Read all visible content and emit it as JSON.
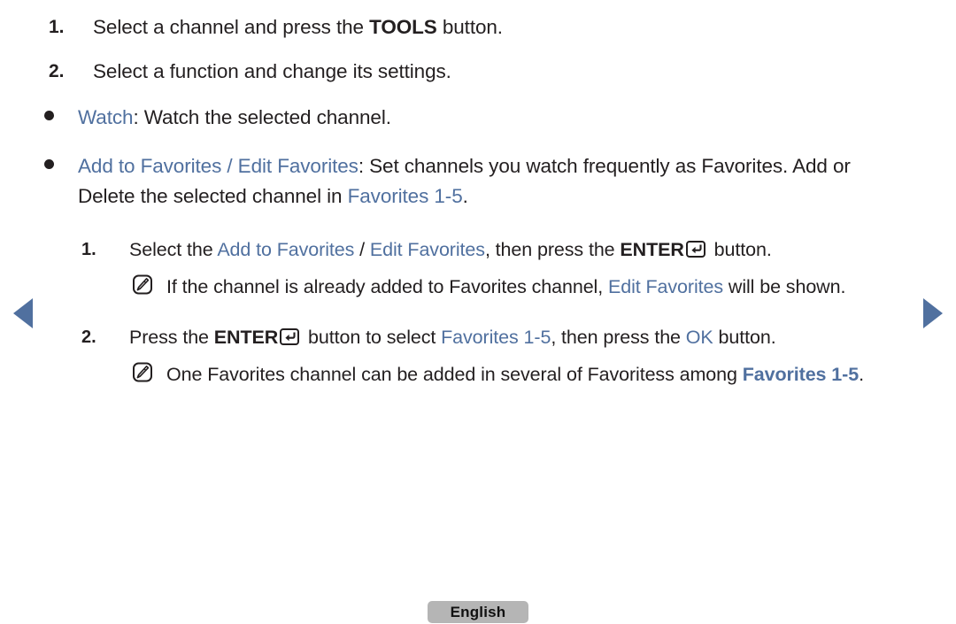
{
  "meta": {
    "accent_blue": "#50709f",
    "text_color": "#231f20",
    "badge_bg": "#b5b5b5",
    "background": "#ffffff"
  },
  "nav": {
    "prev_label": "previous page",
    "next_label": "next page",
    "prev_icon": "triangle-left-icon",
    "next_icon": "triangle-right-icon"
  },
  "steps": [
    {
      "number": "1.",
      "parts": [
        {
          "text": "Select a channel and press the ",
          "style": "plain"
        },
        {
          "text": "TOOLS",
          "style": "bold"
        },
        {
          "text": " button.",
          "style": "plain"
        }
      ]
    },
    {
      "number": "2.",
      "parts": [
        {
          "text": "Select a function and change its settings.",
          "style": "plain"
        }
      ]
    }
  ],
  "bullets": [
    {
      "marker": "bullet-dot",
      "parts": [
        {
          "text": "Watch",
          "style": "blue"
        },
        {
          "text": ": Watch the selected channel.",
          "style": "plain"
        }
      ]
    },
    {
      "marker": "bullet-dot",
      "parts": [
        {
          "text": "Add to Favorites / Edit Favorites",
          "style": "blue"
        },
        {
          "text": ": Set channels you watch frequently as Favorites. Add or Delete the selected channel in ",
          "style": "plain"
        },
        {
          "text": "Favorites 1-5",
          "style": "blue"
        },
        {
          "text": ".",
          "style": "plain"
        }
      ]
    }
  ],
  "substeps": [
    {
      "number": "1.",
      "text_a": "Select the ",
      "link_a": "Add to Favorites",
      "sep": " / ",
      "link_b": "Edit Favorites",
      "text_b": ", then press the ",
      "key": "ENTER",
      "key_icon": "enter-key-icon",
      "text_c": " button."
    },
    {
      "number": "2.",
      "text_a": "Press the ",
      "key": "ENTER",
      "key_icon": "enter-key-icon",
      "text_b": " button to select ",
      "link_a": "Favorites 1-5",
      "text_c": ", then press the ",
      "link_b": "OK",
      "text_d": " button."
    }
  ],
  "notes": [
    {
      "icon": "note-pencil-icon",
      "text_a": "If the channel is already added to Favorites channel, ",
      "link_a": "Edit Favorites",
      "text_b": " will be shown."
    },
    {
      "icon": "note-pencil-icon",
      "text_a": "One Favorites channel can be added in several of Favoritess among ",
      "link_a": "Favorites 1-5",
      "text_b": "."
    }
  ],
  "footer": {
    "language": "English"
  }
}
